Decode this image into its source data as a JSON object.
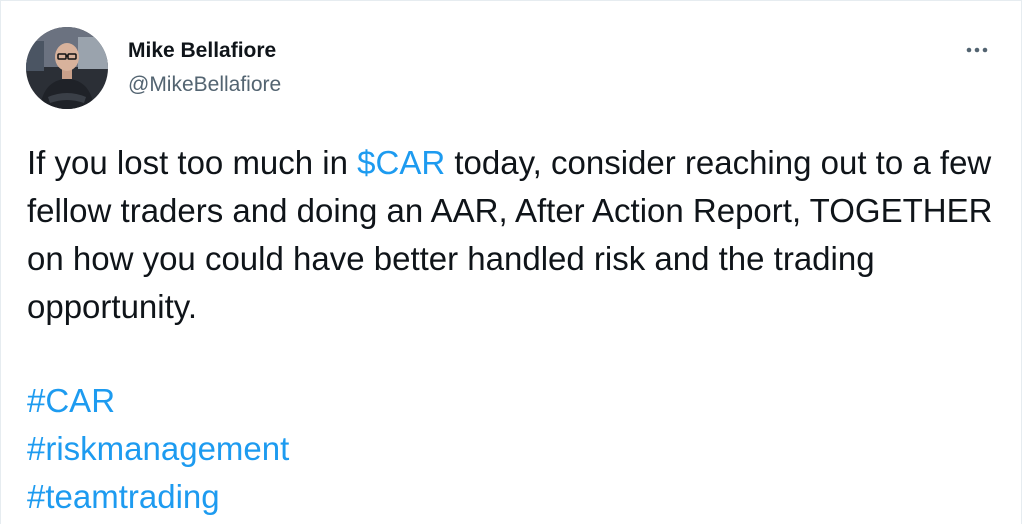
{
  "author": {
    "name": "Mike Bellafiore",
    "handle": "@MikeBellafiore"
  },
  "tweet": {
    "text_before": "If you lost too much in ",
    "cashtag": "$CAR",
    "text_after": " today, consider reaching out to a few fellow traders and doing an AAR, After Action Report, TOGETHER on how you could have better handled risk and the trading opportunity.",
    "hashtags": [
      "#CAR",
      "#riskmanagement",
      "#teamtrading"
    ]
  },
  "icons": {
    "avatar": "profile-photo",
    "more": "more-options-icon"
  },
  "colors": {
    "link": "#1d9bf0",
    "text": "#0f1419",
    "secondary": "#536471"
  }
}
